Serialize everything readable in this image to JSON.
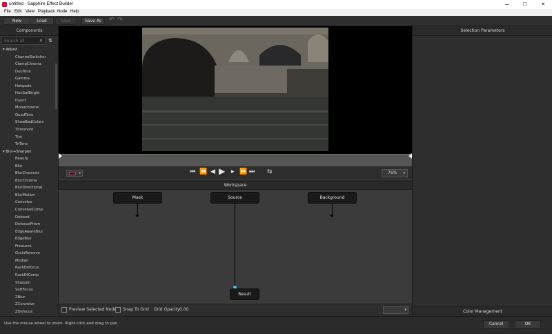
{
  "window": {
    "title": "untitled - Sapphire Effect Builder",
    "minimize": "—",
    "maximize": "☐",
    "close": "✕"
  },
  "menu": [
    "File",
    "Edit",
    "View",
    "Playback",
    "Node",
    "Help"
  ],
  "toolbar": {
    "new": "New",
    "load": "Load",
    "save": "Save",
    "save_as": "Save As",
    "undo_icon": "↶",
    "redo_icon": "↷"
  },
  "components": {
    "header": "Components",
    "search_placeholder": "Search all",
    "search_icon": "magnifier",
    "sort_icon": "sort-az",
    "categories": [
      {
        "name": "Adjust",
        "items": [
          "ChannelSwitcher",
          "ClampChroma",
          "DuoTone",
          "Gamma",
          "Hotspots",
          "HueSatBright",
          "Invert",
          "Monochrome",
          "QuadTone",
          "ShowBadColors",
          "Threshold",
          "Tint",
          "TriTone"
        ]
      },
      {
        "name": "Blur+Sharpen",
        "items": [
          "Beauty",
          "Blur",
          "BlurChannels",
          "BlurChroma",
          "BlurDirectional",
          "BlurMotion",
          "Convolve",
          "ConvolveComp",
          "Deband",
          "DefocusPrism",
          "EdgeAwareBlur",
          "EdgeBlur",
          "FreeLens",
          "GrainRemove",
          "Median",
          "RackDefocus",
          "RackDfComp",
          "Sharpen",
          "SoftFocus",
          "ZBlur",
          "ZConvolve",
          "ZDefocus"
        ]
      }
    ]
  },
  "viewer": {
    "zoom": "76%",
    "controls": [
      "⏮",
      "⏪",
      "◀",
      "▶",
      "▸",
      "⏩",
      "⏭",
      "⇆"
    ]
  },
  "workspace": {
    "header": "Workspace",
    "nodes": {
      "mask": "Mask",
      "source": "Source",
      "background": "Background",
      "result": "Result"
    },
    "preview_selected_node": "Preview Selected Node",
    "snap_to_grid": "Snap To Grid",
    "grid_opacity_label": "Grid Opacity",
    "grid_opacity_value": "0.00"
  },
  "right_panel": {
    "header": "Selection Parameters",
    "color_management": "Color Management"
  },
  "status": {
    "message": "Use the mouse wheel to zoom. Right-click and drag to pan.",
    "cancel": "Cancel",
    "ok": "OK"
  },
  "colors": {
    "accent_port": "#44c1f0",
    "app_icon": "#c8163d",
    "panel_bg": "#2e2e2e",
    "workspace_bg": "#3b3b3b"
  }
}
